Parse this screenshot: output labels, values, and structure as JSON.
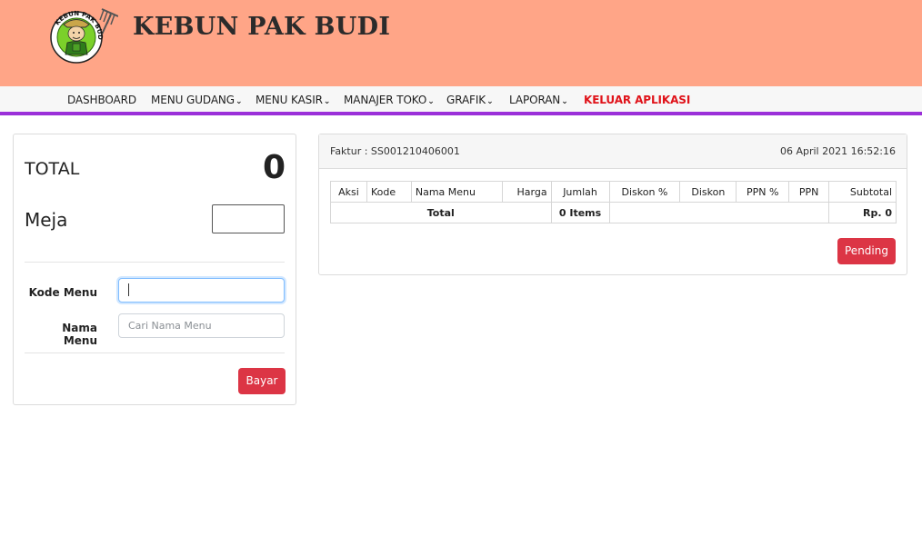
{
  "header": {
    "brand": "KEBUN PAK BUDI",
    "logo_text": "KEBUN PAK BUDI"
  },
  "nav": {
    "items": [
      {
        "label": "DASHBOARD",
        "dropdown": false
      },
      {
        "label": "MENU GUDANG",
        "dropdown": true
      },
      {
        "label": "MENU KASIR",
        "dropdown": true
      },
      {
        "label": "MANAJER TOKO",
        "dropdown": true
      },
      {
        "label": "GRAFIK",
        "dropdown": true
      },
      {
        "label": "LAPORAN",
        "dropdown": true
      }
    ],
    "logout_label": "KELUAR APLIKASI",
    "chevron_glyph": "❯"
  },
  "pos": {
    "total_label": "TOTAL",
    "total_value": "0",
    "meja_label": "Meja",
    "meja_value": "",
    "kode_menu_label": "Kode Menu",
    "kode_menu_value": "",
    "nama_menu_label": "Nama Menu",
    "nama_menu_placeholder": "Cari Nama Menu",
    "bayar_label": "Bayar"
  },
  "invoice": {
    "faktur": "Faktur : SS001210406001",
    "datetime": "06 April 2021 16:52:16",
    "columns": [
      "Aksi",
      "Kode",
      "Nama Menu",
      "Harga",
      "Jumlah",
      "Diskon %",
      "Diskon",
      "PPN %",
      "PPN",
      "Subtotal"
    ],
    "total_label": "Total",
    "total_items": "0 Items",
    "total_amount": "Rp. 0",
    "pending_label": "Pending"
  },
  "colors": {
    "header_bg": "#ffa587",
    "nav_accent": "#9b30d9",
    "logout": "#e0131a",
    "button_red": "#dc3545"
  }
}
